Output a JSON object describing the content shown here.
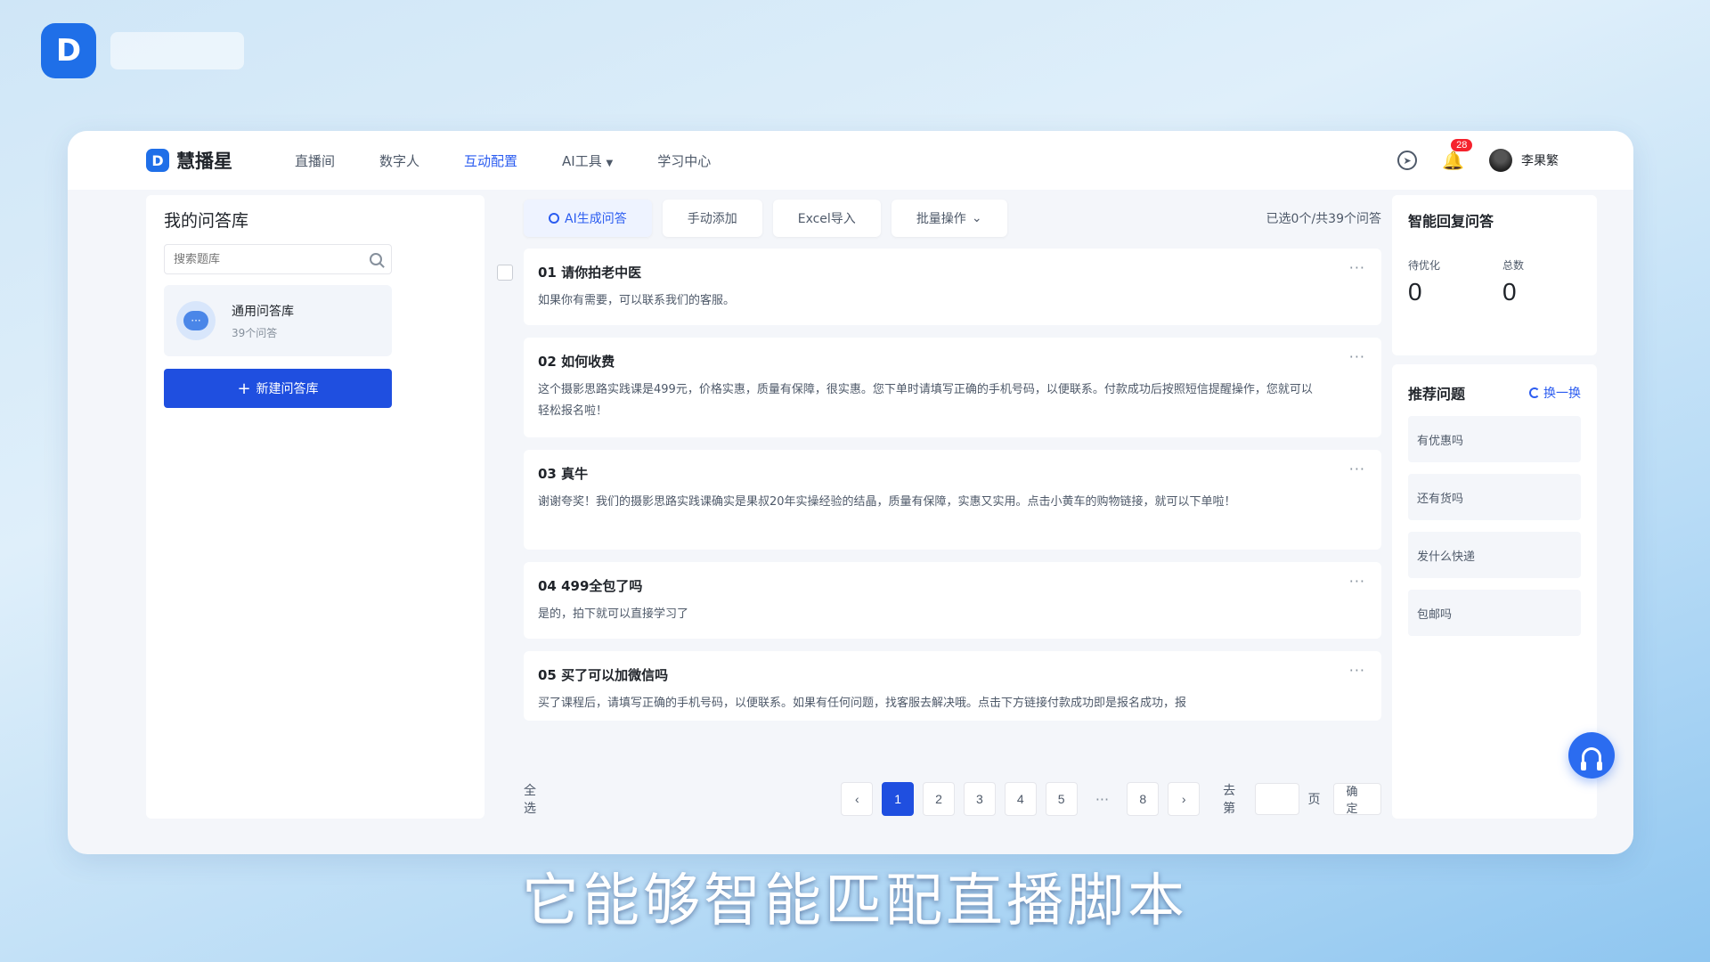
{
  "app": {
    "name": "慧播星",
    "nav": [
      {
        "label": "直播间"
      },
      {
        "label": "数字人"
      },
      {
        "label": "互动配置",
        "active": true
      },
      {
        "label": "AI工具"
      },
      {
        "label": "学习中心"
      }
    ],
    "notifications": "28",
    "user": "李果繁"
  },
  "left": {
    "title": "我的问答库",
    "search_placeholder": "搜索题库",
    "library": {
      "name": "通用问答库",
      "count": "39个问答"
    },
    "new_button": "新建问答库"
  },
  "main": {
    "tabs": [
      "AI生成问答",
      "手动添加",
      "Excel导入",
      "批量操作"
    ],
    "selected_count": "已选0个/共39个问答",
    "items": [
      {
        "q": "01 请你拍老中医",
        "a": "如果你有需要，可以联系我们的客服。"
      },
      {
        "q": "02 如何收费",
        "a": "这个摄影思路实践课是499元，价格实惠，质量有保障，很实惠。您下单时请填写正确的手机号码，以便联系。付款成功后按照短信提醒操作，您就可以轻松报名啦！"
      },
      {
        "q": "03 真牛",
        "a": "谢谢夸奖！我们的摄影思路实践课确实是果叔20年实操经验的结晶，质量有保障，实惠又实用。点击小黄车的购物链接，就可以下单啦！"
      },
      {
        "q": "04 499全包了吗",
        "a": "是的，拍下就可以直接学习了"
      },
      {
        "q": "05 买了可以加微信吗",
        "a": "买了课程后，请填写正确的手机号码，以便联系。如果有任何问题，找客服去解决哦。点击下方链接付款成功即是报名成功，报"
      }
    ],
    "pager": {
      "select_all": "全选",
      "pages": [
        "1",
        "2",
        "3",
        "4",
        "5",
        "8"
      ],
      "current": "1",
      "goto": "去第",
      "page_unit": "页",
      "confirm": "确定"
    }
  },
  "right": {
    "smart_title": "智能回复问答",
    "stats": [
      {
        "label": "待优化",
        "value": "0"
      },
      {
        "label": "总数",
        "value": "0"
      }
    ],
    "rec_title": "推荐问题",
    "refresh": "换一换",
    "recommendations": [
      "有优惠吗",
      "还有货吗",
      "发什么快递",
      "包邮吗"
    ]
  },
  "subtitle": "它能够智能匹配直播脚本",
  "colors": {
    "accent": "#1f4fe0",
    "badge": "#f5222d"
  }
}
